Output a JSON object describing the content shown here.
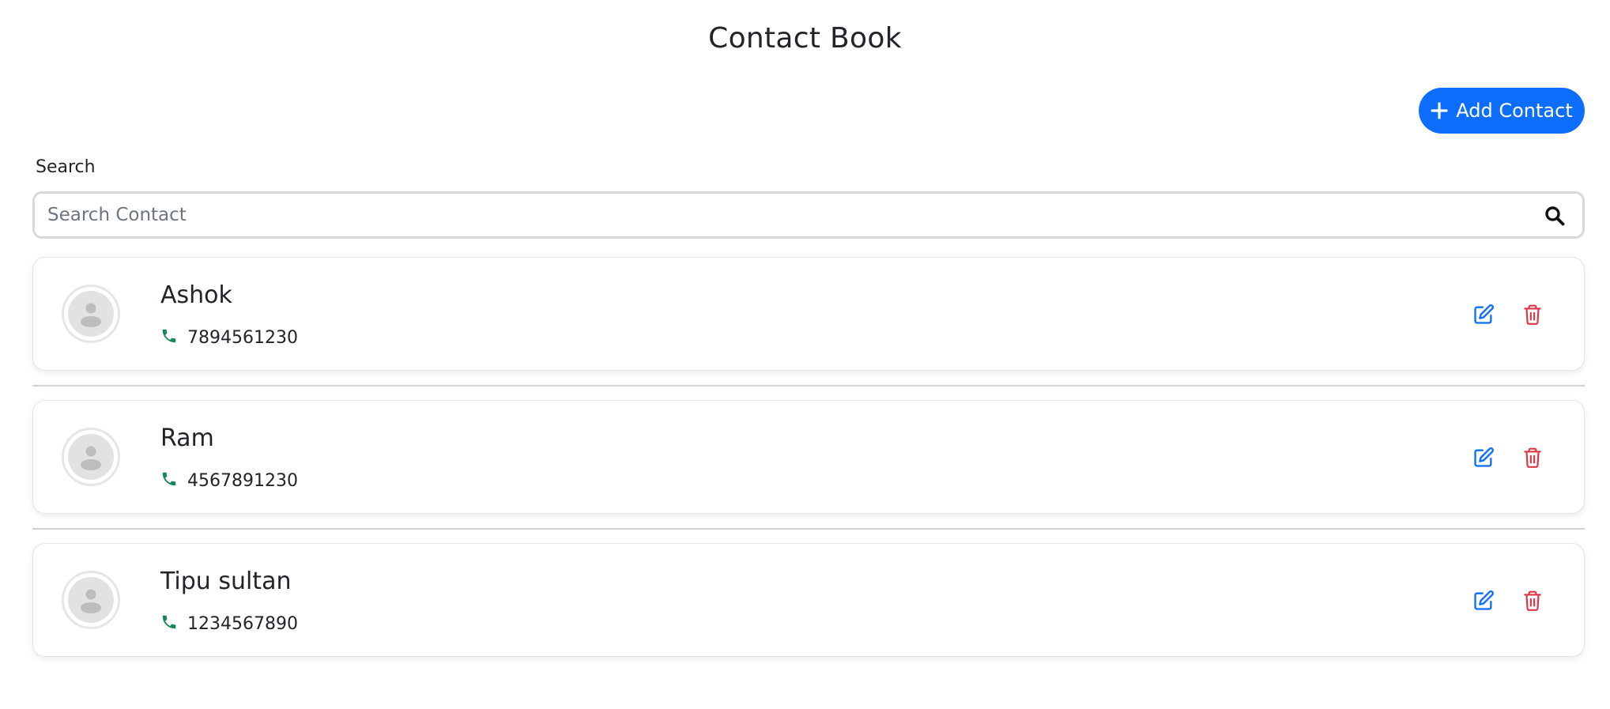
{
  "header": {
    "title": "Contact Book"
  },
  "toolbar": {
    "add_label": "Add Contact"
  },
  "search": {
    "label": "Search",
    "placeholder": "Search Contact",
    "value": ""
  },
  "contacts": [
    {
      "name": "Ashok",
      "phone": "7894561230"
    },
    {
      "name": "Ram",
      "phone": "4567891230"
    },
    {
      "name": "Tipu sultan",
      "phone": "1234567890"
    }
  ],
  "icons": {
    "add": "plus-icon",
    "search": "search-icon",
    "avatar": "user-icon",
    "phone": "phone-icon",
    "edit": "edit-icon",
    "delete": "trash-icon"
  },
  "colors": {
    "primary": "#0d6efd",
    "danger": "#dc3545",
    "success": "#198754",
    "text": "#212529",
    "muted": "#6c757d"
  }
}
